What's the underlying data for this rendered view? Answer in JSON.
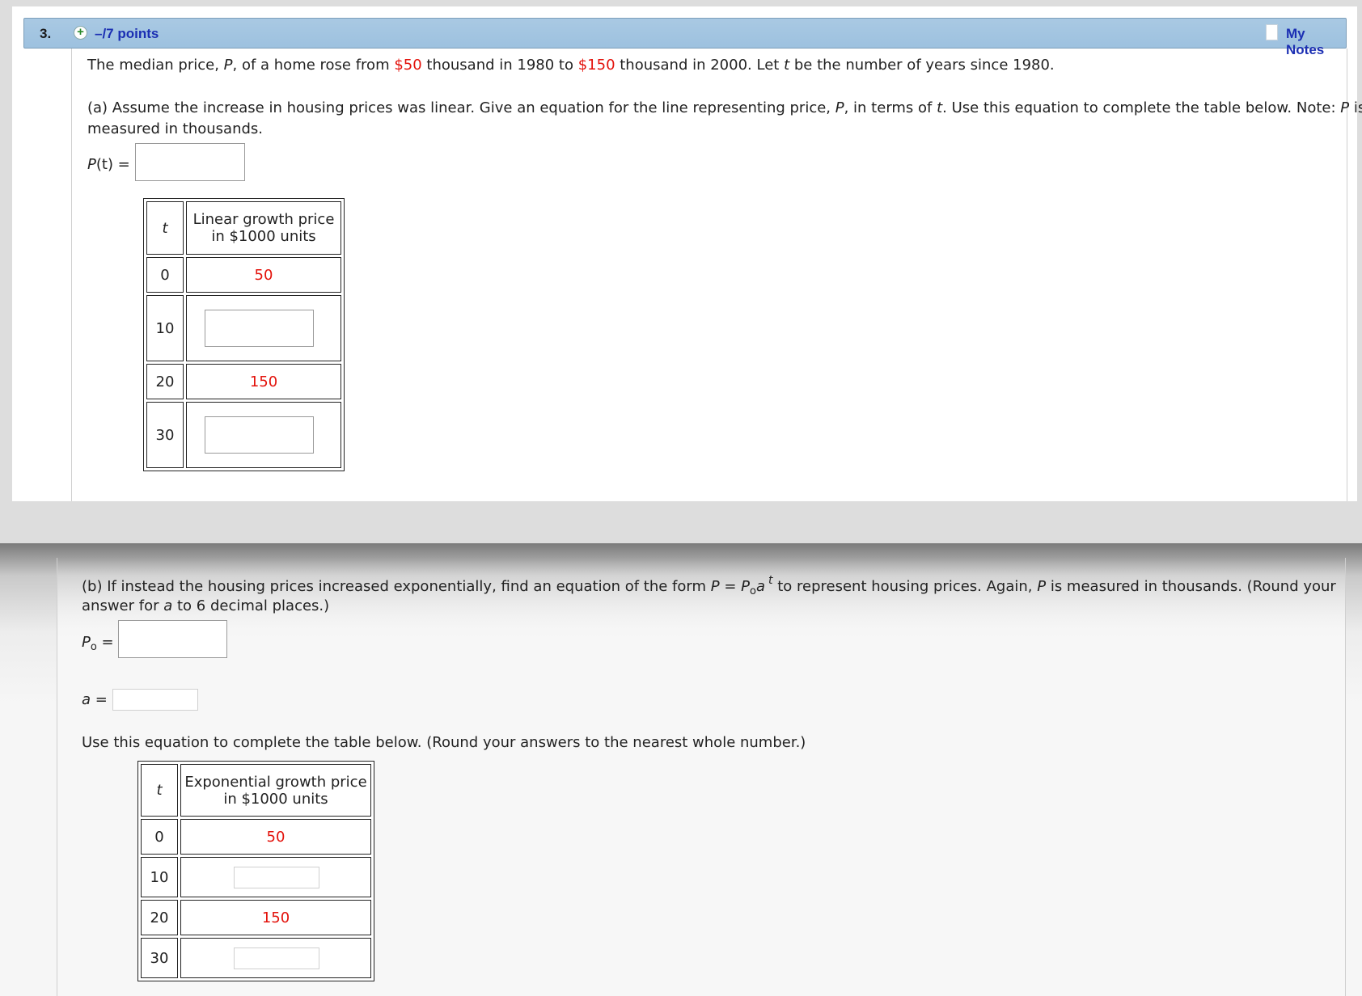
{
  "question": {
    "number": "3.",
    "points": "–/7 points",
    "notes": "My Notes"
  },
  "intro": {
    "p1": "The median price, ",
    "var_P": "P",
    "p2": ", of a home rose from ",
    "price_start": "$50",
    "p3": " thousand in 1980 to ",
    "price_end": "$150",
    "p4": " thousand in 2000. Let ",
    "var_t": "t",
    "p5": " be the number of years since 1980."
  },
  "part_a": {
    "line1_a": "(a) Assume the increase in housing prices was linear. Give an equation for the line representing price, ",
    "line1_P": "P",
    "line1_b": ", in terms of ",
    "line1_t": "t",
    "line1_c": ". Use this equation to complete the table below. Note: ",
    "line1_P2": "P",
    "line1_d": " is",
    "line2": "measured in thousands.",
    "eq_label_P": "P",
    "eq_label_rest": "(t) =",
    "eq_value": "",
    "table": {
      "col_t": "t",
      "col_price_1": "Linear growth price",
      "col_price_2": "in $1000 units",
      "rows": [
        {
          "t": "0",
          "price": "50"
        },
        {
          "t": "10",
          "price": ""
        },
        {
          "t": "20",
          "price": "150"
        },
        {
          "t": "30",
          "price": ""
        }
      ]
    }
  },
  "part_b": {
    "line1_a": "(b) If instead the housing prices increased exponentially, find an equation of the form ",
    "form_P": "P",
    "form_eq": " = ",
    "form_P0": "P",
    "form_o": "o",
    "form_a": "a",
    "form_t": "t",
    "line1_b": " to represent housing prices. Again, ",
    "line1_P": "P",
    "line1_c": " is measured in thousands. (Round your",
    "line2_a": "answer for ",
    "line2_var": "a",
    "line2_b": " to 6 decimal places.)",
    "p0_label_P": "P",
    "p0_label_o": "o",
    "p0_label_eq": " =",
    "p0_value": "",
    "a_label": "a",
    "a_label_eq": " =",
    "a_value": "",
    "instruction": "Use this equation to complete the table below. (Round your answers to the nearest whole number.)",
    "table": {
      "col_t": "t",
      "col_price_1": "Exponential growth price",
      "col_price_2": "in $1000 units",
      "rows": [
        {
          "t": "0",
          "price": "50"
        },
        {
          "t": "10",
          "price": ""
        },
        {
          "t": "20",
          "price": "150"
        },
        {
          "t": "30",
          "price": ""
        }
      ]
    }
  },
  "colors": {
    "header_bg": "#a9c9e3",
    "link": "#1b2fb3",
    "given_value": "#e3120b"
  },
  "icons": [
    "plus-circle-icon",
    "notes-page-icon"
  ]
}
